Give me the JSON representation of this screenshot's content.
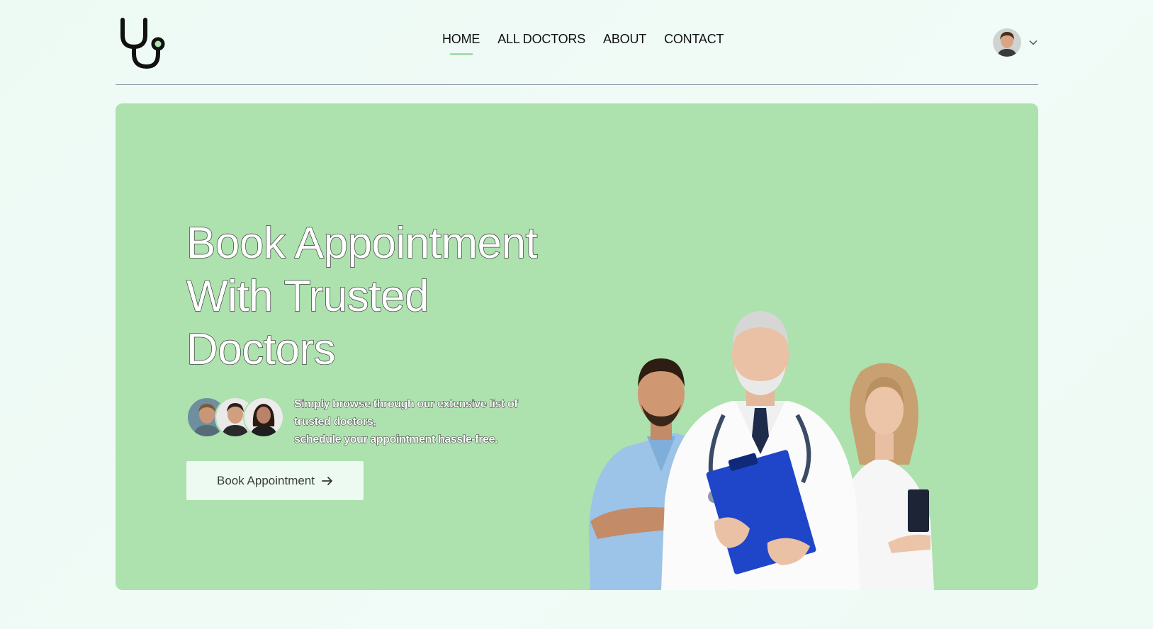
{
  "navbar": {
    "logo_icon": "stethoscope-icon",
    "links": [
      {
        "label": "HOME",
        "active": true
      },
      {
        "label": "ALL DOCTORS",
        "active": false
      },
      {
        "label": "ABOUT",
        "active": false
      },
      {
        "label": "CONTACT",
        "active": false
      }
    ],
    "profile_icon": "chevron-down-icon"
  },
  "hero": {
    "title_lines": [
      "Book Appointment",
      "With Trusted",
      "Doctors"
    ],
    "description_lines": [
      "Simply browse through our extensive list of",
      "trusted doctors,",
      "schedule your appointment hassle-free."
    ],
    "cta_label": "Book Appointment",
    "cta_icon": "arrow-right-icon"
  },
  "colors": {
    "page_bg": "#eefbf5",
    "hero_bg": "#ade1ae",
    "active_underline": "#a4dfa9",
    "cta_bg": "#edfaf1",
    "clipboard": "#1f45c9"
  }
}
